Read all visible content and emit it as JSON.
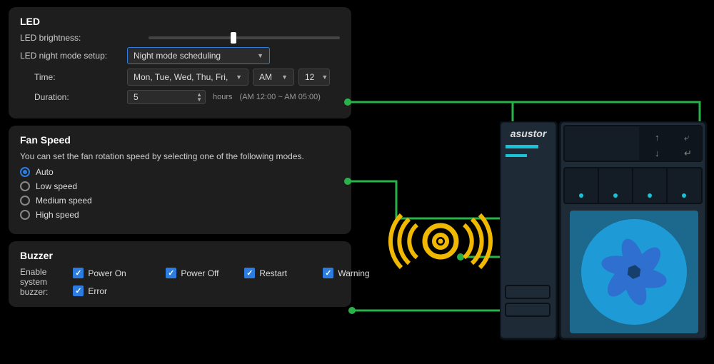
{
  "brand": "asustor",
  "led": {
    "title": "LED",
    "brightness_label": "LED brightness:",
    "brightness_pct": 40,
    "night_mode_label": "LED night mode setup:",
    "night_mode_value": "Night mode scheduling",
    "time_label": "Time:",
    "days_value": "Mon, Tue, Wed, Thu, Fri, Sat, Sun",
    "ampm_value": "AM",
    "hour_value": "12",
    "duration_label": "Duration:",
    "duration_value": "5",
    "duration_unit": "hours",
    "duration_hint": "(AM 12:00 ~ AM 05:00)"
  },
  "fan": {
    "title": "Fan Speed",
    "desc": "You can set the fan rotation speed by selecting one of the following modes.",
    "selected": "Auto",
    "options": [
      "Auto",
      "Low speed",
      "Medium speed",
      "High speed"
    ]
  },
  "buzzer": {
    "title": "Buzzer",
    "enable_label": "Enable system buzzer:",
    "options": [
      {
        "label": "Power On",
        "checked": true
      },
      {
        "label": "Power Off",
        "checked": true
      },
      {
        "label": "Restart",
        "checked": true
      },
      {
        "label": "Warning",
        "checked": true
      },
      {
        "label": "Error",
        "checked": true
      }
    ]
  },
  "colors": {
    "accent": "#2d7de0",
    "connector": "#2ab24a",
    "buzzer_icon": "#f0b800",
    "device_body": "#1e2a36",
    "device_led": "#19c3d6",
    "fan_housing": "#1e9bd6",
    "fan_blade": "#2e6fd0"
  }
}
